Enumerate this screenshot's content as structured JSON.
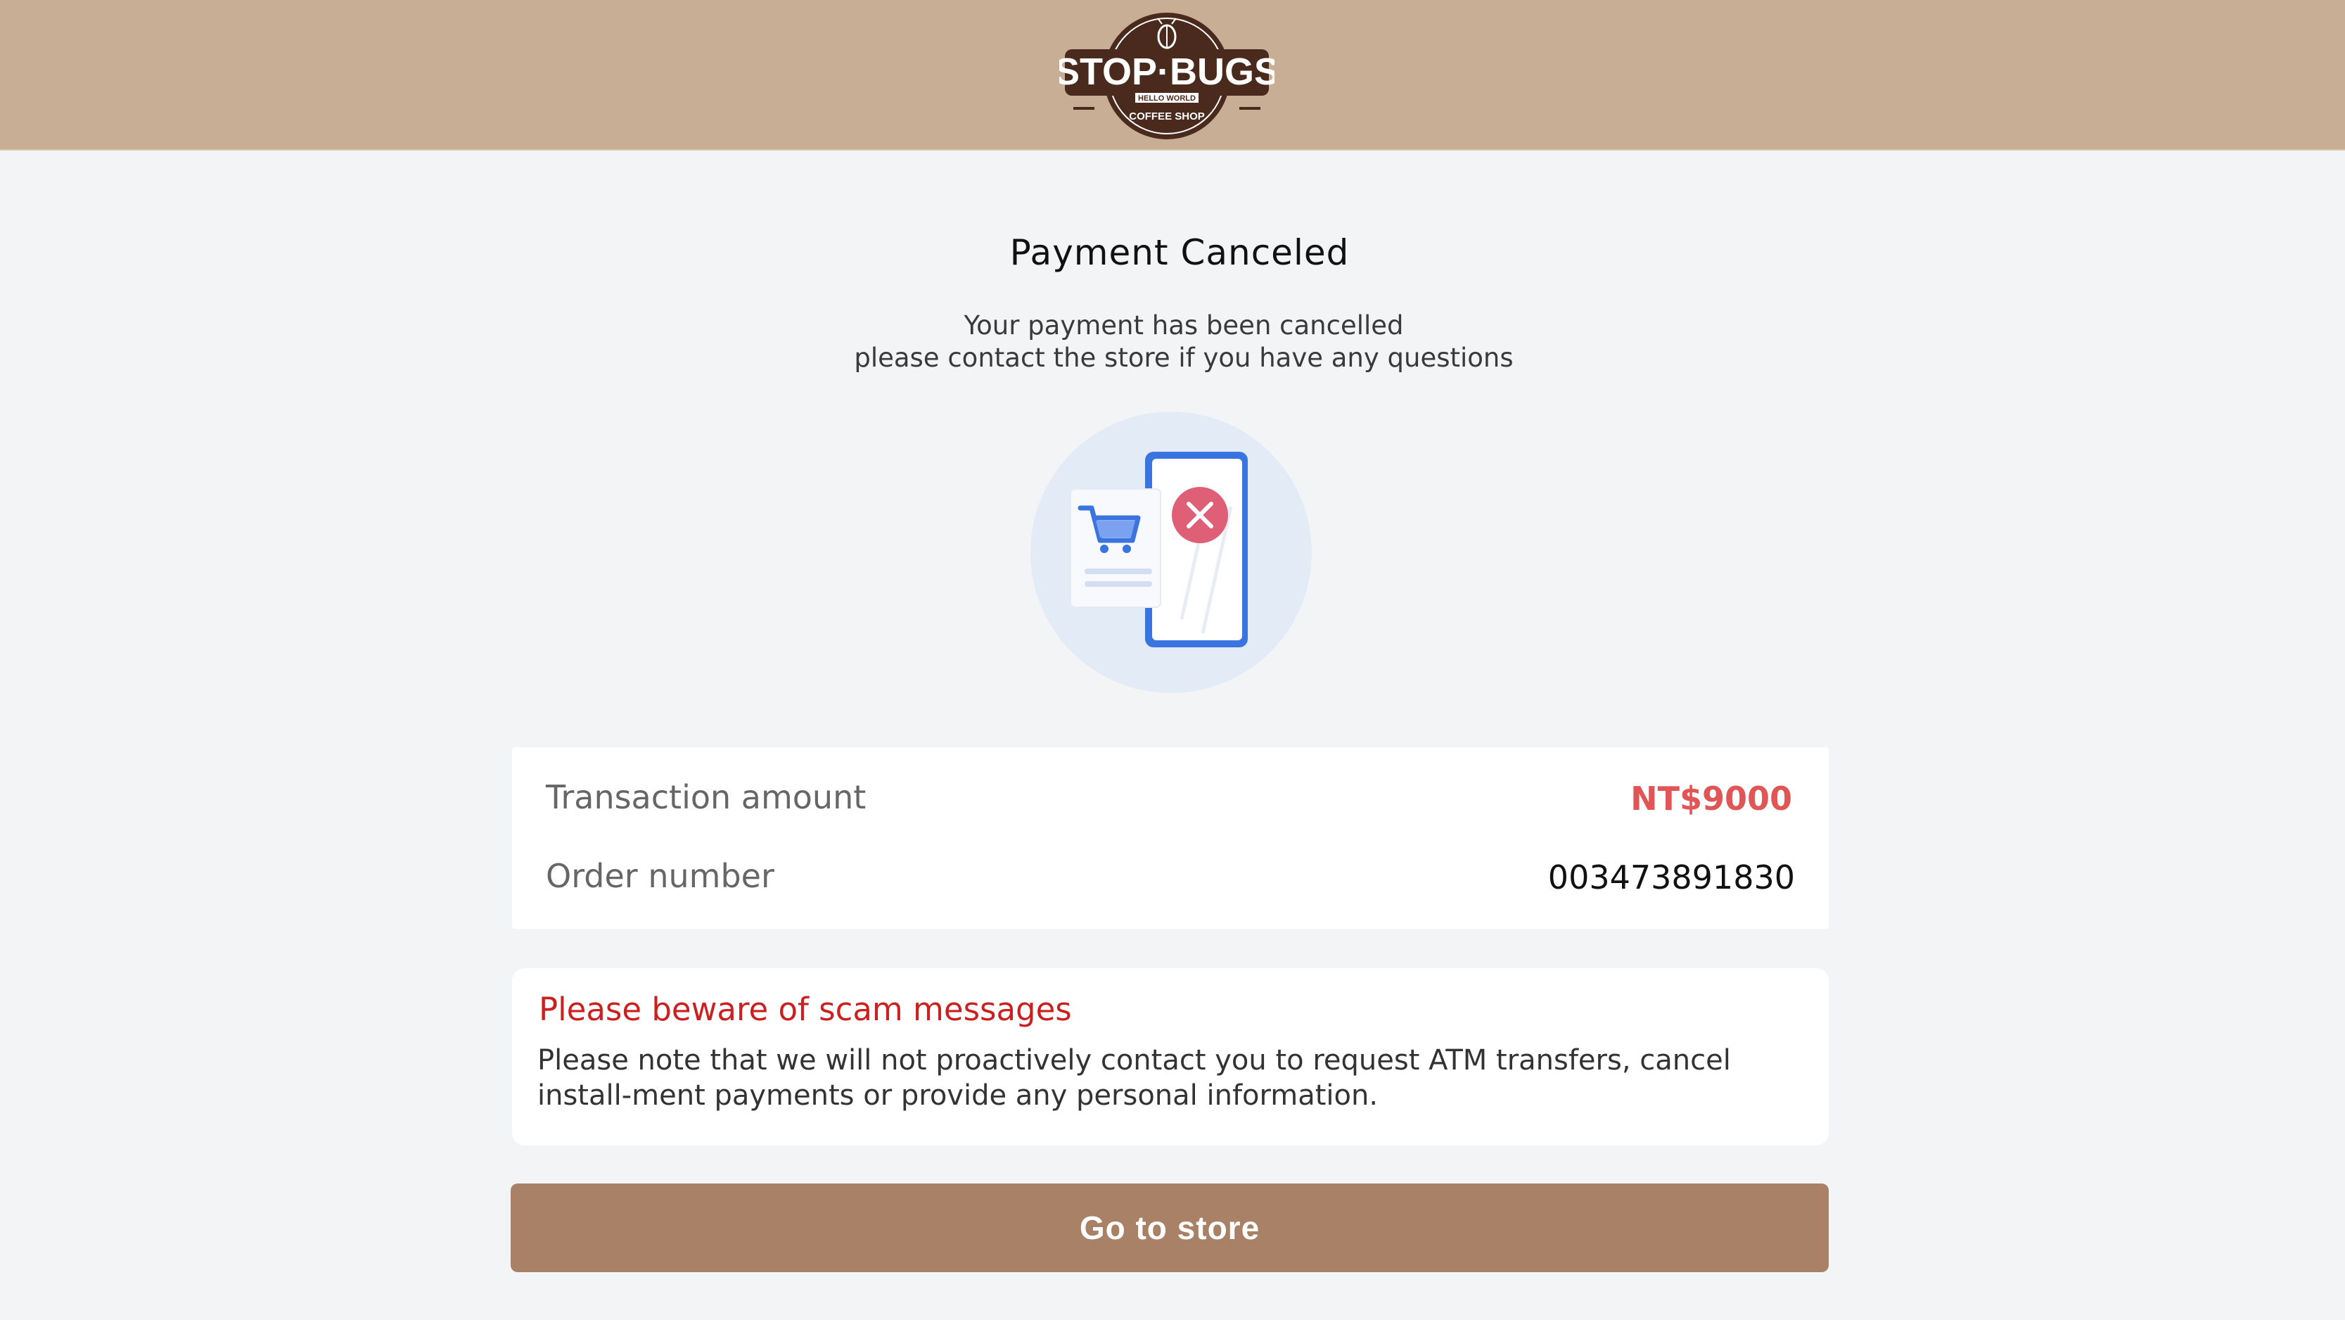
{
  "brand": {
    "logo_text": "STOP·BUGS",
    "logo_tagline": "HELLO WORLD",
    "logo_subtext": "COFFEE SHOP",
    "header_color": "#c7ae94"
  },
  "status": {
    "title": "Payment Canceled",
    "message_line1": "Your payment has been cancelled",
    "message_line2": "please contact the store if you have any questions",
    "illustration": "cancelled-payment-phone-cart-icon"
  },
  "transaction": {
    "amount_label": "Transaction amount",
    "amount_value": "NT$9000",
    "order_label": "Order number",
    "order_value": "003473891830",
    "amount_color": "#e05555"
  },
  "warning": {
    "title": "Please beware of scam messages",
    "body": "Please note that we will not proactively contact you to request ATM transfers, cancel install-ment payments or provide any personal information.",
    "title_color": "#cc1f1f"
  },
  "actions": {
    "go_to_store_label": "Go to store",
    "button_color": "#a98167"
  }
}
